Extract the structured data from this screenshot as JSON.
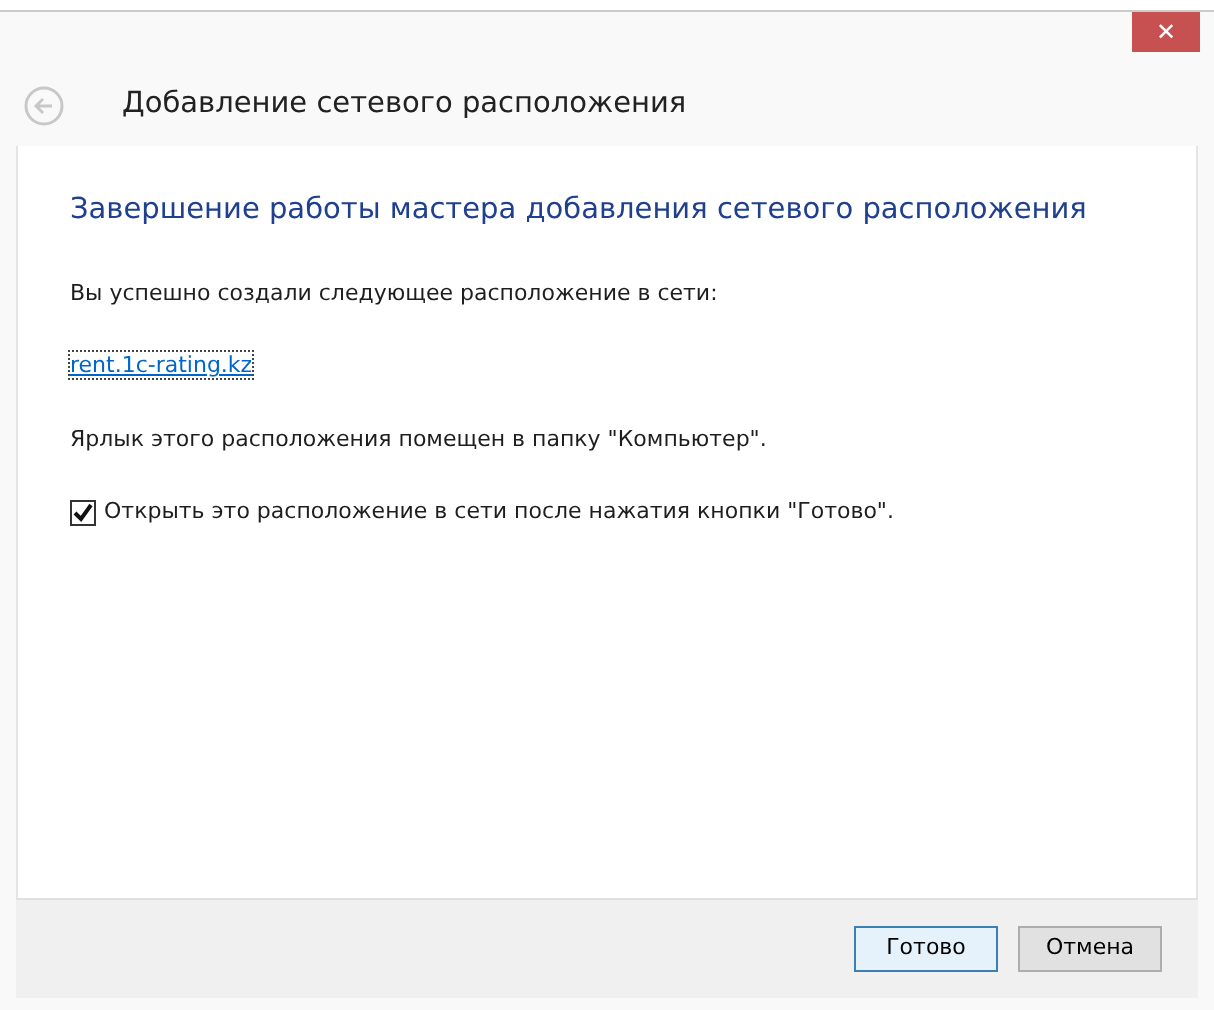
{
  "window": {
    "close": "✕",
    "title": "Добавление сетевого расположения"
  },
  "heading": "Завершение работы мастера добавления сетевого расположения",
  "message": "Вы успешно создали следующее расположение в сети:",
  "link": "rent.1c-rating.kz",
  "note": "Ярлык этого расположения помещен в папку \"Компьютер\".",
  "option": {
    "label": "Открыть это расположение в сети после нажатия кнопки \"Готово\".",
    "checked": true
  },
  "buttons": [
    {
      "label": "Готово",
      "default": true
    },
    {
      "label": "Отмена",
      "default": false
    }
  ]
}
